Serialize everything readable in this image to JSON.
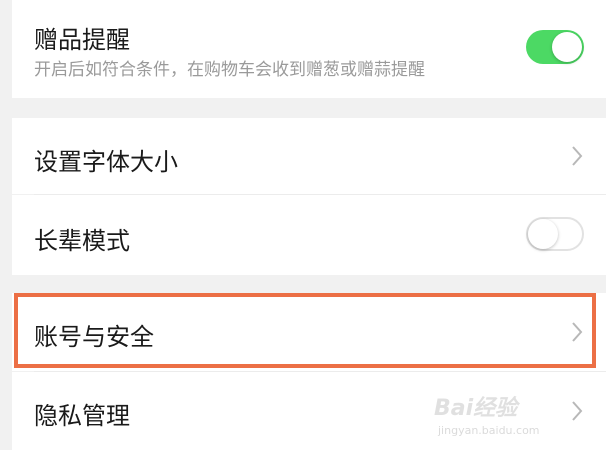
{
  "settings": {
    "gift_reminder": {
      "label": "赠品提醒",
      "description": "开启后如符合条件，在购物车会收到赠葱或赠蒜提醒",
      "toggle_state": "on"
    },
    "font_size": {
      "label": "设置字体大小"
    },
    "elder_mode": {
      "label": "长辈模式",
      "toggle_state": "off"
    },
    "account_security": {
      "label": "账号与安全"
    },
    "privacy": {
      "label": "隐私管理"
    }
  },
  "colors": {
    "toggle_on": "#4cd964",
    "highlight_border": "#ec6f45",
    "background": "#f1f1f1"
  },
  "watermark": {
    "logo_text": "Bai经验",
    "url_text": "jingyan.baidu.com"
  }
}
